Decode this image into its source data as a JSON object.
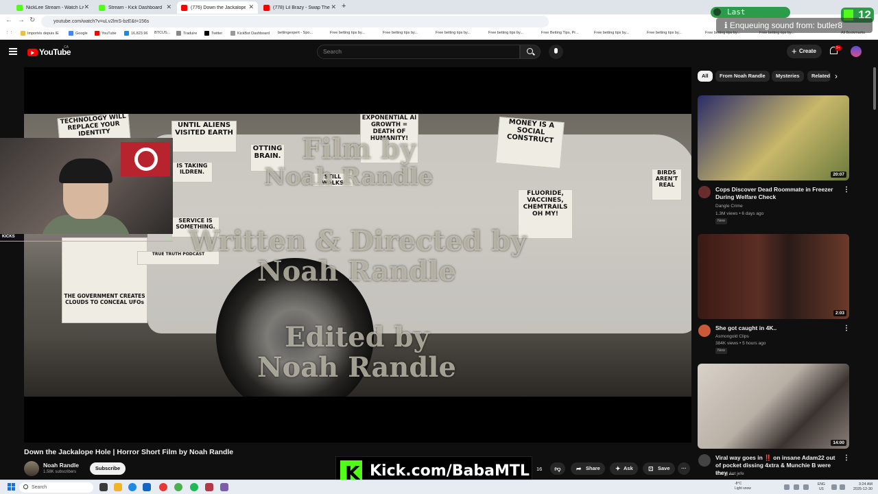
{
  "browser": {
    "tabs": [
      {
        "label": "NickLee Stream - Watch Live o...",
        "color": "#53fc18",
        "active": false
      },
      {
        "label": "Stream - Kick Dashboard",
        "color": "#53fc18",
        "active": false
      },
      {
        "label": "(776) Down the Jackalope H...",
        "color": "#ff0000",
        "active": true
      },
      {
        "label": "(778) Lil Brazy - Swap The Gun...",
        "color": "#ff0000",
        "active": false
      }
    ],
    "url": "youtube.com/watch?v=uLv2lmS-bzE&t=156s",
    "bookmarks": [
      "Importés depuis IE",
      "Google",
      "YouTube",
      "16,823.96",
      "BTCUS...",
      "Traduire",
      "Twitter",
      "KickBot Dashboard",
      "bettingexpert - Spo...",
      "Free betting tips by...",
      "Free betting tips by...",
      "Free betting tips by...",
      "Free betting tips by...",
      "Free Betting Tips, Pr...",
      "Free betting tips by...",
      "Free betting tips by...",
      "Free betting tips by...",
      "Free betting tips by..."
    ],
    "all_bookmarks": "All Bookmarks"
  },
  "overlay": {
    "last_subscriber": "Last Subscriber",
    "kick_count": "12",
    "enqueue": "Enqueuing sound from: butler8"
  },
  "youtube": {
    "logo": "YouTube",
    "country": "CA",
    "search_placeholder": "Search",
    "create_label": "Create",
    "notifications": "9+"
  },
  "video": {
    "credit_film": "Film by",
    "credit_name1": "Noah Randle",
    "credit_written": "Written & Directed by",
    "credit_name2": "Noah Randle",
    "credit_edited": "Edited by",
    "credit_name3": "Noah Randle",
    "posters": {
      "p1": "TECHNOLOGY WILL REPLACE YOUR IDENTITY",
      "p2": "UNTIL ALIENS VISITED EARTH",
      "p3": "EXPONENTIAL AI GROWTH = DEATH OF HUMANITY!",
      "p4": "MONEY IS A SOCIAL CONSTRUCT",
      "p5": "STILL WALKS",
      "p6": "FLUORIDE, VACCINES, CHEMTRAILS OH MY!",
      "p7": "BIRDS AREN'T REAL",
      "p8": "THE GOVERNMENT CREATES CLOUDS TO CONCEAL UFOs",
      "p9": "TRUE TRUTH PODCAST",
      "p10": "SERVICE IS SOMETHING.",
      "p11": "IS TAKING ILDREN.",
      "p12": "OTTING BRAIN."
    },
    "webcam_label": "KICKS",
    "title": "Down the Jackalope Hole | Horror Short Film by Noah Randle",
    "channel": "Noah Randle",
    "subscribers": "1.58K subscribers",
    "subscribe": "Subscribe",
    "likes": "16",
    "share": "Share",
    "ask": "Ask",
    "save": "Save"
  },
  "kick_banner": "Kick.com/BabaMTL",
  "chips": [
    "All",
    "From Noah Randle",
    "Mysteries",
    "Related"
  ],
  "recommendations": [
    {
      "title": "Cops Discover Dead Roommate in Freezer During Welfare Check",
      "channel": "Dangle Crime",
      "meta": "1.3M views • 6 days ago",
      "badge": "New",
      "duration": "20:07",
      "thumb_color": "#c9b86a",
      "avatar_color": "#6a2d2d"
    },
    {
      "title": "She got caught in 4K..",
      "channel": "Asmongold Clips",
      "meta": "384K views • 5 hours ago",
      "badge": "New",
      "duration": "2:03",
      "thumb_color": "#5a2e24",
      "avatar_color": "#c85a3a"
    },
    {
      "title": "Viral way goes in ‼️ on insane Adam22 out of pocket dissing 4xtra & Munchie B were they ...",
      "channel": "Young Ant jefe",
      "meta": "",
      "badge": "",
      "duration": "14:00",
      "thumb_color": "#b9b0a6",
      "avatar_color": "#444444"
    }
  ],
  "taskbar": {
    "search": "Search",
    "weather_temp": "-8°C",
    "weather_desc": "Light snow",
    "lang1": "ENG",
    "lang2": "US",
    "time": "3:24 AM",
    "date": "2025-12-30"
  }
}
